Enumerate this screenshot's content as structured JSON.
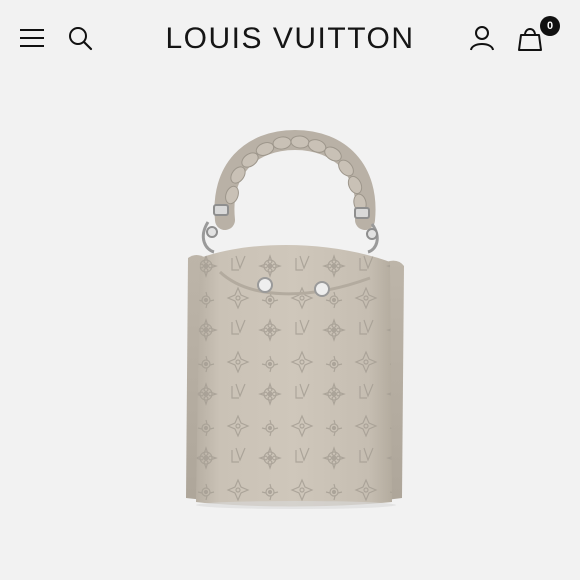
{
  "header": {
    "brand": "LOUIS VUITTON",
    "bag_count": "0",
    "icons": {
      "menu": "hamburger-menu-icon",
      "search": "search-icon",
      "account": "account-icon",
      "bag": "shopping-bag-icon"
    }
  },
  "product": {
    "image": "monogram-bucket-bag-image",
    "colors": {
      "leather": "#c7bfb3",
      "handle": "#b9b1a6"
    }
  },
  "colors": {
    "background": "#f2f2f2",
    "text": "#111111"
  }
}
